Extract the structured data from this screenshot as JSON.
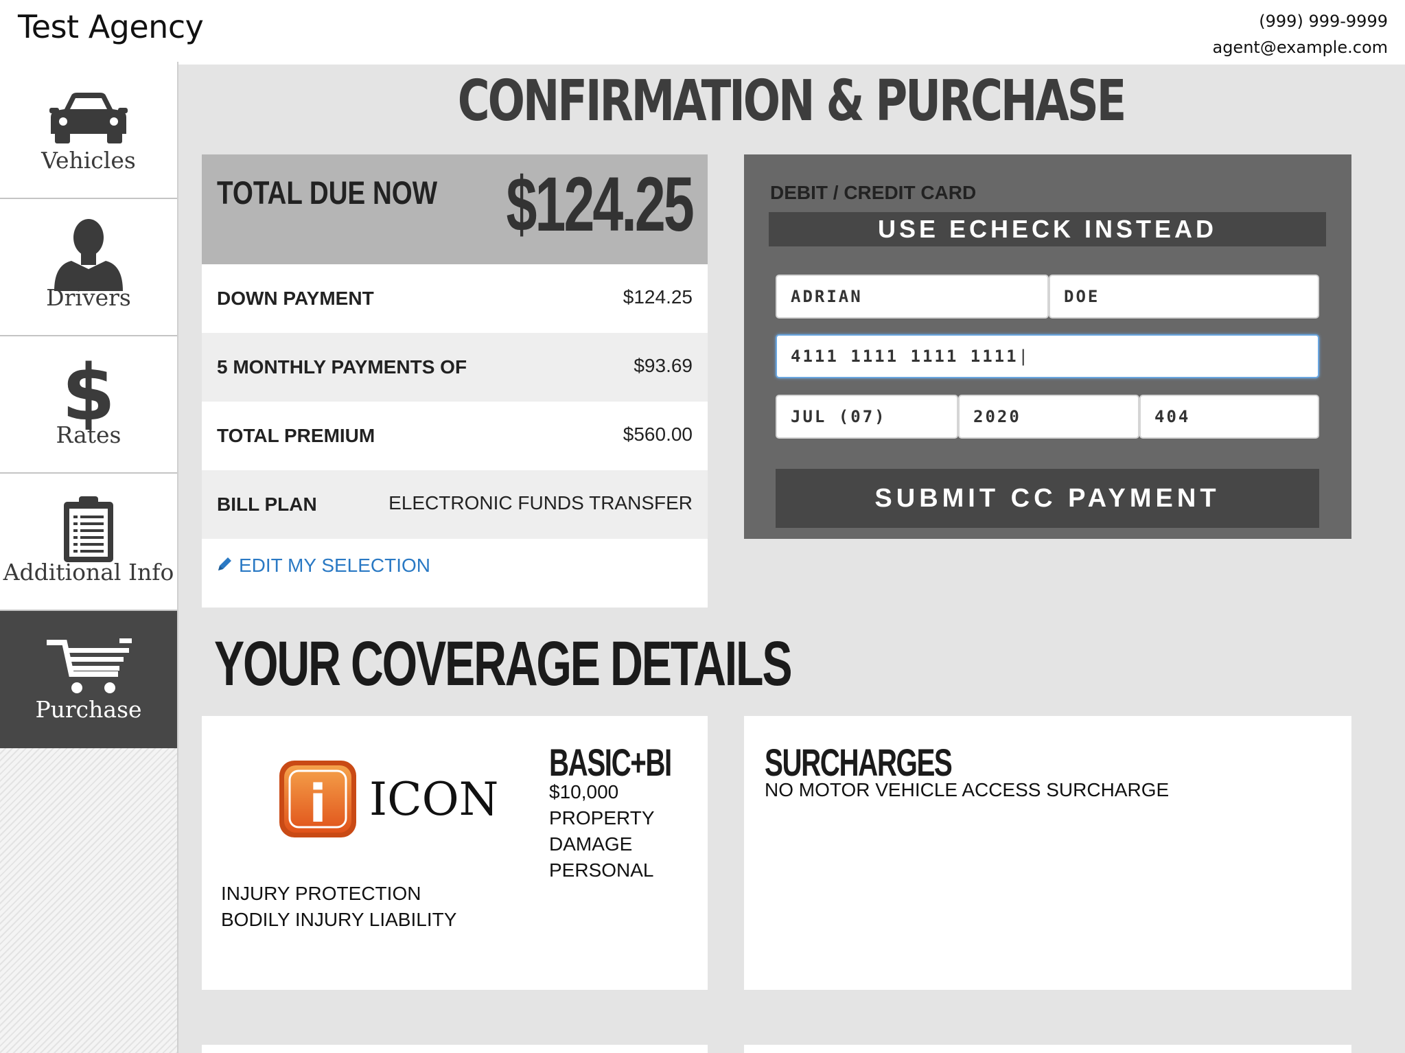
{
  "header": {
    "agency": "Test Agency",
    "phone": "(999) 999-9999",
    "email": "agent@example.com"
  },
  "sidebar": {
    "items": [
      {
        "label": "Vehicles",
        "icon": "car-icon"
      },
      {
        "label": "Drivers",
        "icon": "person-icon"
      },
      {
        "label": "Rates",
        "icon": "dollar-icon"
      },
      {
        "label": "Additional Info",
        "icon": "clipboard-icon"
      },
      {
        "label": "Purchase",
        "icon": "cart-icon",
        "active": true
      }
    ]
  },
  "page": {
    "title": "CONFIRMATION & PURCHASE"
  },
  "summary": {
    "total_label": "TOTAL DUE NOW",
    "total_value": "$124.25",
    "rows": [
      {
        "label": "DOWN PAYMENT",
        "value": "$124.25"
      },
      {
        "label": "5 MONTHLY PAYMENTS OF",
        "value": "$93.69"
      },
      {
        "label": "TOTAL PREMIUM",
        "value": "$560.00"
      },
      {
        "label": "BILL PLAN",
        "value": "ELECTRONIC FUNDS TRANSFER"
      }
    ],
    "edit_link": "EDIT MY SELECTION"
  },
  "payment": {
    "label": "DEBIT / CREDIT CARD",
    "echeck_button": "USE ECHECK INSTEAD",
    "first_name": "ADRIAN",
    "last_name": "DOE",
    "card_number": "4111 1111 1111 1111",
    "exp_month": "JUL (07)",
    "exp_year": "2020",
    "cvv": "404",
    "submit_button": "SUBMIT CC PAYMENT"
  },
  "coverage": {
    "title": "YOUR COVERAGE DETAILS",
    "logo_text": "ICON",
    "logo_letter": "i",
    "plan_title": "BASIC+BI",
    "plan_lines": [
      "$10,000",
      "PROPERTY",
      "DAMAGE",
      "PERSONAL"
    ],
    "coverage_lines": [
      "INJURY PROTECTION",
      "BODILY INJURY LIABILITY"
    ],
    "surcharges_title": "SURCHARGES",
    "surcharges_text": "NO MOTOR VEHICLE ACCESS SURCHARGE"
  },
  "colors": {
    "accent": "#474747",
    "link": "#2a79c4",
    "logo_orange": "#e8621c"
  }
}
